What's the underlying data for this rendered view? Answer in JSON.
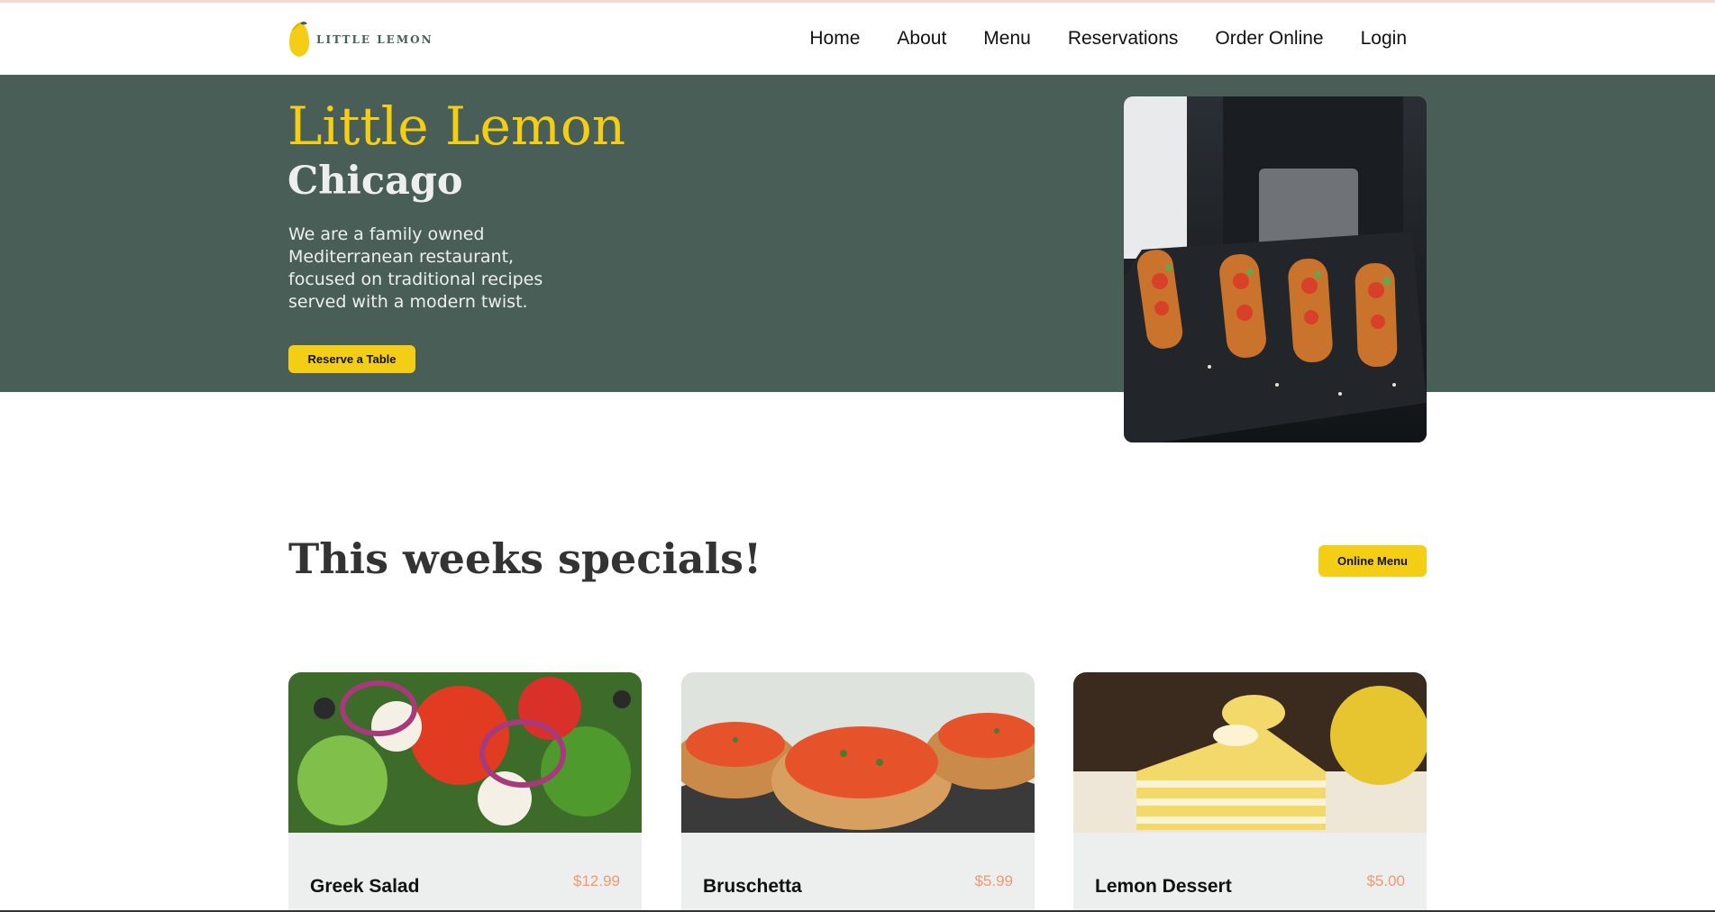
{
  "brand": {
    "name": "LITTLE LEMON"
  },
  "nav": {
    "items": [
      {
        "label": "Home"
      },
      {
        "label": "About"
      },
      {
        "label": "Menu"
      },
      {
        "label": "Reservations"
      },
      {
        "label": "Order Online"
      },
      {
        "label": "Login"
      }
    ]
  },
  "hero": {
    "title": "Little Lemon",
    "subtitle": "Chicago",
    "description": "We are a family owned Mediterranean restaurant, focused on traditional recipes served with a modern twist.",
    "button_label": "Reserve a Table"
  },
  "specials": {
    "title": "This weeks specials!",
    "button_label": "Online Menu",
    "cards": [
      {
        "name": "Greek Salad",
        "price": "$12.99"
      },
      {
        "name": "Bruschetta",
        "price": "$5.99"
      },
      {
        "name": "Lemon Dessert",
        "price": "$5.00"
      }
    ]
  },
  "colors": {
    "primary_green": "#495e57",
    "primary_yellow": "#f4ce14",
    "highlight_light": "#edefee",
    "price_orange": "#ee9972"
  }
}
